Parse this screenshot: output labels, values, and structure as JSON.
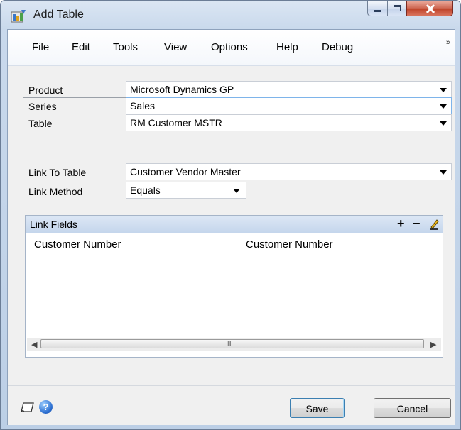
{
  "window": {
    "title": "Add Table"
  },
  "menu": {
    "items": [
      "File",
      "Edit",
      "Tools",
      "View",
      "Options",
      "Help",
      "Debug"
    ],
    "overflow": "»"
  },
  "form": {
    "product": {
      "label": "Product",
      "value": "Microsoft Dynamics GP"
    },
    "series": {
      "label": "Series",
      "value": "Sales"
    },
    "table": {
      "label": "Table",
      "value": "RM Customer MSTR"
    },
    "link_to_table": {
      "label": "Link To Table",
      "value": "Customer Vendor Master"
    },
    "link_method": {
      "label": "Link Method",
      "value": "Equals"
    }
  },
  "link_fields": {
    "title": "Link Fields",
    "icons": [
      "plus-icon",
      "minus-icon",
      "edit-pencil-icon"
    ],
    "rows": [
      {
        "left": "Customer Number",
        "right": "Customer Number"
      }
    ],
    "scroll_grip": "III"
  },
  "footer": {
    "save_label": "Save",
    "cancel_label": "Cancel",
    "icons": [
      "note-icon",
      "help-icon"
    ]
  },
  "colors": {
    "accent": "#3c7fb1",
    "header": "#c5d6ec",
    "close": "#c0452c"
  }
}
